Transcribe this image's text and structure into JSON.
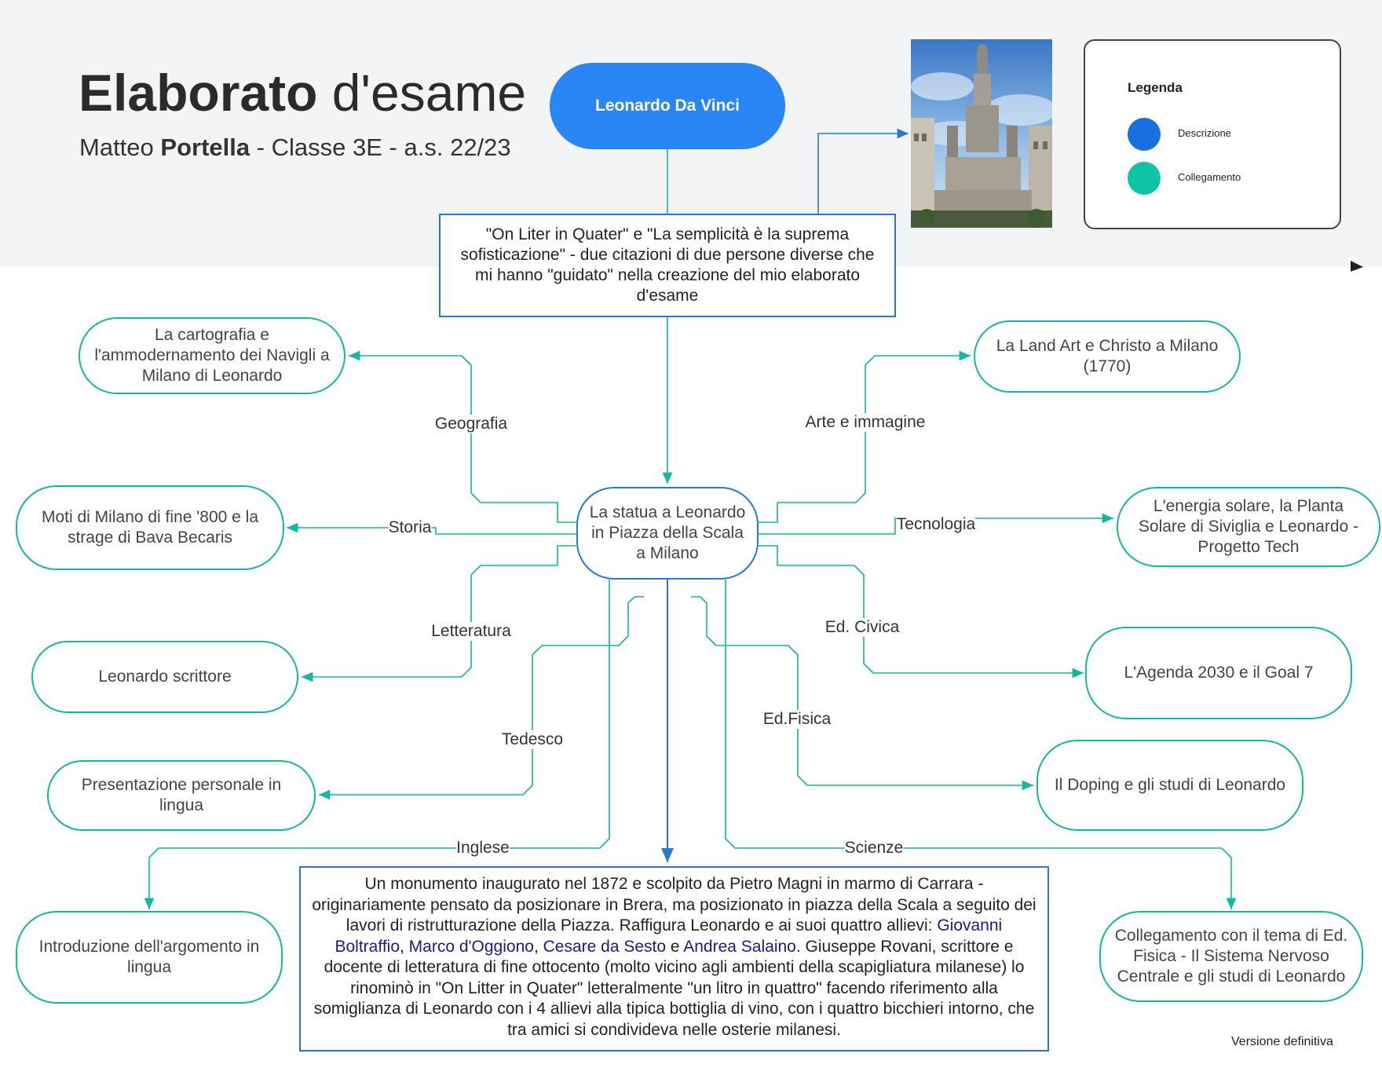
{
  "header": {
    "title_bold": "Elaborato",
    "title_rest": " d'esame",
    "subtitle_pre": "Matteo ",
    "subtitle_bold": "Portella",
    "subtitle_post": " - Classe 3E - a.s. 22/23"
  },
  "root_label": "Leonardo Da Vinci",
  "quote_box": "\"On Liter in Quater\" e \"La semplicità è la suprema sofisticazione\" - due citazioni di due persone diverse che mi hanno \"guidato\" nella creazione del mio elaborato d'esame",
  "center_label": "La statua a Leonardo in Piazza della Scala a Milano",
  "legend": {
    "title": "Legenda",
    "items": [
      {
        "label": "Descrizione",
        "color": "#1a6fe0"
      },
      {
        "label": "Collegamento",
        "color": "#0cc4a6"
      }
    ]
  },
  "branches": {
    "geografia": {
      "subject": "Geografia",
      "topic": "La cartografia e l'ammodernamento dei Navigli a Milano di Leonardo"
    },
    "storia": {
      "subject": "Storia",
      "topic": "Moti di Milano di fine '800 e la strage di Bava Becaris"
    },
    "letteratura": {
      "subject": "Letteratura",
      "topic": "Leonardo scrittore"
    },
    "tedesco": {
      "subject": "Tedesco",
      "topic": "Presentazione personale in lingua"
    },
    "inglese": {
      "subject": "Inglese",
      "topic": "Introduzione dell'argomento in lingua"
    },
    "arte": {
      "subject": "Arte e immagine",
      "topic": "La Land Art e Christo a Milano (1770)"
    },
    "tecnologia": {
      "subject": "Tecnologia",
      "topic": "L'energia solare, la Planta Solare di Siviglia e Leonardo - Progetto Tech"
    },
    "civica": {
      "subject": "Ed. Civica",
      "topic": "L'Agenda 2030 e il Goal 7"
    },
    "fisica": {
      "subject": "Ed.Fisica",
      "topic": "Il Doping e gli studi di Leonardo"
    },
    "scienze": {
      "subject": "Scienze",
      "topic": "Collegamento con il tema di Ed. Fisica - Il Sistema Nervoso Centrale e gli studi di Leonardo"
    }
  },
  "description": {
    "part1": "Un monumento inaugurato nel 1872 e scolpito da Pietro Magni in marmo di Carrara - originariamente pensato da posizionare in Brera, ma posizionato in  piazza della Scala a seguito dei lavori di ristrutturazione della Piazza. Raffigura Leonardo e ai suoi quattro allievi: ",
    "pupil1": "Giovanni Boltraffio",
    "sep1": ", ",
    "pupil2": "Marco d'Oggiono",
    "sep2": ", ",
    "pupil3": "Cesare da Sesto",
    "sep3": " e ",
    "pupil4": "Andrea Salaino",
    "part2": ". Giuseppe Rovani, scrittore e docente di letteratura di fine ottocento (molto vicino agli ambienti della scapigliatura milanese) lo rinominò in \"On Litter in Quater\" letteralmente \"un litro in quattro\" facendo riferimento alla somiglianza di Leonardo con i 4 allievi alla tipica bottiglia di vino, con i quattro bicchieri intorno, che tra amici si condivideva nelle osterie milanesi."
  },
  "footer": "Versione definitiva"
}
